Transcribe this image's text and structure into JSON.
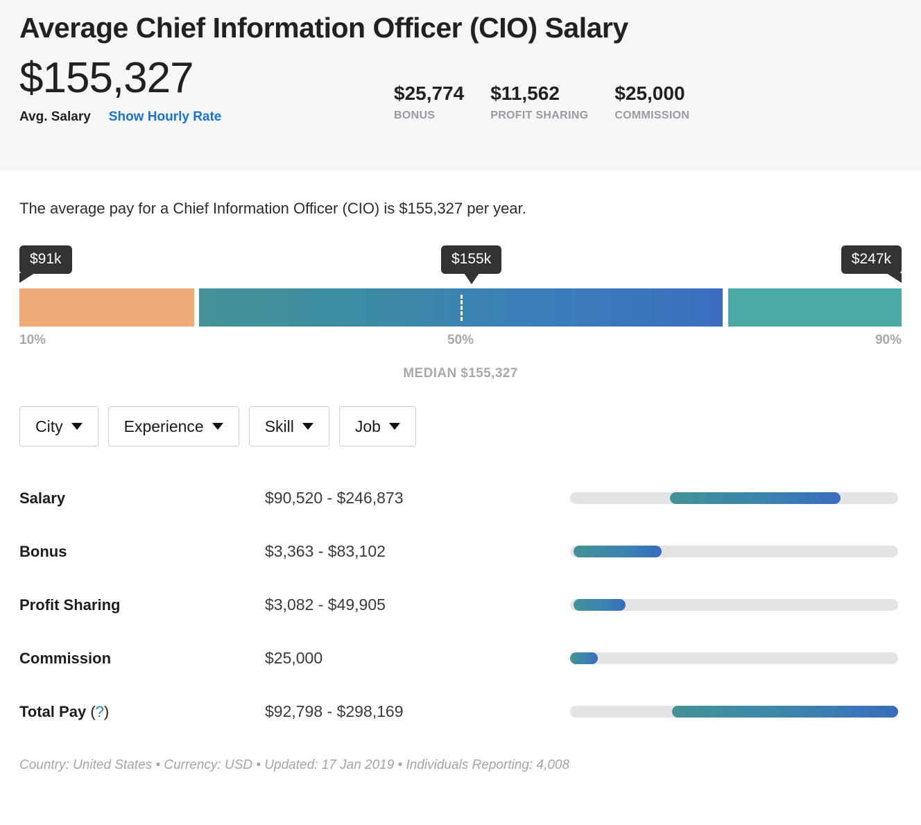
{
  "header": {
    "title": "Average Chief Information Officer (CIO) Salary",
    "avg_amount": "$155,327",
    "avg_label": "Avg. Salary",
    "hourly_link": "Show Hourly Rate",
    "stats": [
      {
        "value": "$25,774",
        "name": "BONUS"
      },
      {
        "value": "$11,562",
        "name": "PROFIT SHARING"
      },
      {
        "value": "$25,000",
        "name": "COMMISSION"
      }
    ]
  },
  "intro": "The average pay for a Chief Information Officer (CIO) is $155,327 per year.",
  "range": {
    "tip_low": "$91k",
    "tip_mid": "$155k",
    "tip_high": "$247k",
    "pct_low": "10%",
    "pct_mid": "50%",
    "pct_high": "90%",
    "median_text": "MEDIAN $155,327"
  },
  "filters": [
    {
      "label": "City"
    },
    {
      "label": "Experience"
    },
    {
      "label": "Skill"
    },
    {
      "label": "Job"
    }
  ],
  "table": {
    "rows": [
      {
        "label": "Salary",
        "value": "$90,520 - $246,873",
        "bar_start": 30.5,
        "bar_end": 82.5
      },
      {
        "label": "Bonus",
        "value": "$3,363 - $83,102",
        "bar_start": 1.0,
        "bar_end": 28.0
      },
      {
        "label": "Profit Sharing",
        "value": "$3,082 - $49,905",
        "bar_start": 1.0,
        "bar_end": 17.0
      },
      {
        "label": "Commission",
        "value": "$25,000",
        "bar_start": 0.0,
        "bar_end": 8.5
      },
      {
        "label": "Total Pay",
        "value": "$92,798 - $298,169",
        "bar_start": 31.0,
        "bar_end": 100.0,
        "help": "(?)"
      }
    ]
  },
  "footnote": "Country: United States  •  Currency: USD  •  Updated: 17 Jan 2019  •  Individuals Reporting: 4,008",
  "colors": {
    "accent_link": "#1a73d4",
    "band_low": "#eeab77",
    "band_mid_start": "#429296",
    "band_mid_end": "#3a6cbe",
    "band_high": "#4aa9a2",
    "track": "#e4e4e4",
    "header_bg": "#f5f6f7",
    "tooltip_bg": "#333333",
    "muted_text": "#a7a9af"
  },
  "chart_data": {
    "type": "bar",
    "title": "Average Chief Information Officer (CIO) Salary",
    "subtitle": "The average pay for a Chief Information Officer (CIO) is $155,327 per year.",
    "percentile_range": {
      "categories": [
        "10%",
        "50%",
        "90%"
      ],
      "labels": [
        "$91k",
        "$155k",
        "$247k"
      ],
      "values": [
        91000,
        155327,
        247000
      ],
      "median": 155327,
      "median_label": "MEDIAN $155,327"
    },
    "compensation_breakdown": {
      "categories": [
        "Salary",
        "Bonus",
        "Profit Sharing",
        "Commission",
        "Total Pay"
      ],
      "ranges": [
        {
          "name": "Salary",
          "low": 90520,
          "high": 246873,
          "display": "$90,520 - $246,873"
        },
        {
          "name": "Bonus",
          "low": 3363,
          "high": 83102,
          "display": "$3,363 - $83,102"
        },
        {
          "name": "Profit Sharing",
          "low": 3082,
          "high": 49905,
          "display": "$3,082 - $49,905"
        },
        {
          "name": "Commission",
          "low": 25000,
          "high": 25000,
          "display": "$25,000"
        },
        {
          "name": "Total Pay",
          "low": 92798,
          "high": 298169,
          "display": "$92,798 - $298,169"
        }
      ],
      "xlabel": "",
      "ylabel": "",
      "grid": false,
      "legend": "none"
    },
    "summary_stats": {
      "avg_salary": 155327,
      "bonus": 25774,
      "profit_sharing": 11562,
      "commission": 25000
    },
    "meta": {
      "country": "United States",
      "currency": "USD",
      "updated": "17 Jan 2019",
      "individuals_reporting": "4,008"
    }
  }
}
